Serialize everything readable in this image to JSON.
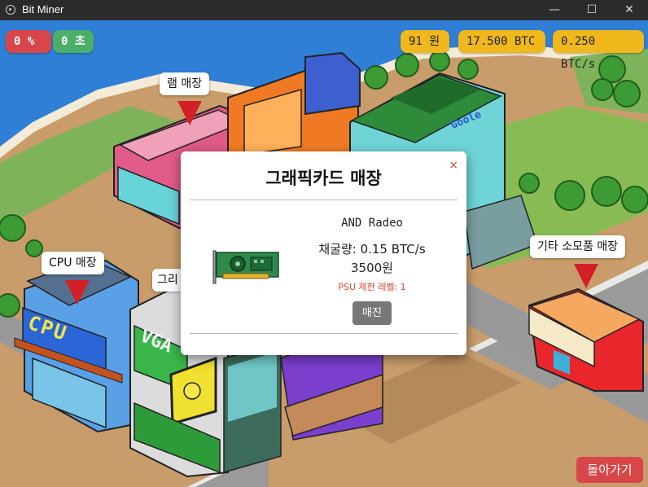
{
  "window": {
    "title": "Bit Miner",
    "minimize": "—",
    "maximize": "☐",
    "close": "✕"
  },
  "hud": {
    "percent": "0 %",
    "seconds": "0 초",
    "money": "91 원",
    "btc": "17.500 BTC",
    "rate": "0.250 BTC/s"
  },
  "stores": {
    "ram": "램 매장",
    "cpu": "CPU 매장",
    "gpu_partial": "그리",
    "etc": "기타 소모품 매장"
  },
  "signs": {
    "cpu_sign": "CPU",
    "vga_sign": "VGA",
    "google_sign": "Goole"
  },
  "modal": {
    "title": "그래픽카드 매장",
    "close": "×",
    "item_name": "AND Radeo",
    "rate": "채굴량: 0.15 BTC/s",
    "price": "3500원",
    "psu": "PSU 제한 레벨: 1",
    "button": "매진"
  },
  "back_button": "돌아가기",
  "colors": {
    "red": "#d9464a",
    "green": "#4caf69",
    "yellow": "#f0b81c",
    "pin": "#d32027"
  }
}
